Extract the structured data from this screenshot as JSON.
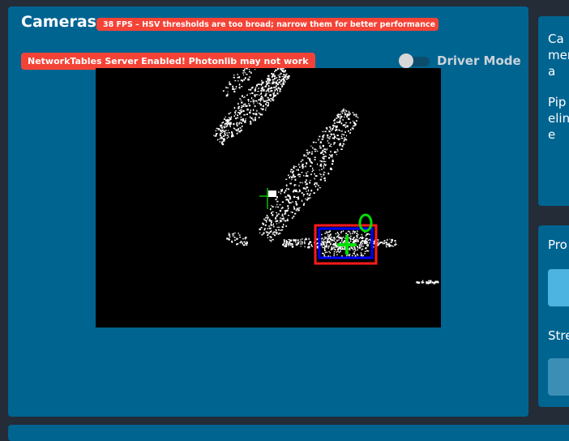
{
  "cameras_card": {
    "title": "Cameras",
    "fps_warning": "38 FPS – HSV thresholds are too broad; narrow them for better performance",
    "nt_warning": "NetworkTables Server Enabled! Photonlib may not work",
    "driver_mode_label": "Driver Mode",
    "driver_mode_on": false
  },
  "right_card_1": {
    "camera_label_partial": "Camera",
    "pipeline_label_partial": "Pipeline"
  },
  "right_card_2": {
    "processing_label_partial": "Pro",
    "stream_label_partial": "Stre"
  },
  "colors": {
    "card_bg": "#006491",
    "page_bg": "#232c37",
    "warning_chip": "#f44336",
    "target_box": "#ff1a1a",
    "contour": "#0000ff",
    "crosshair": "#00e000"
  }
}
